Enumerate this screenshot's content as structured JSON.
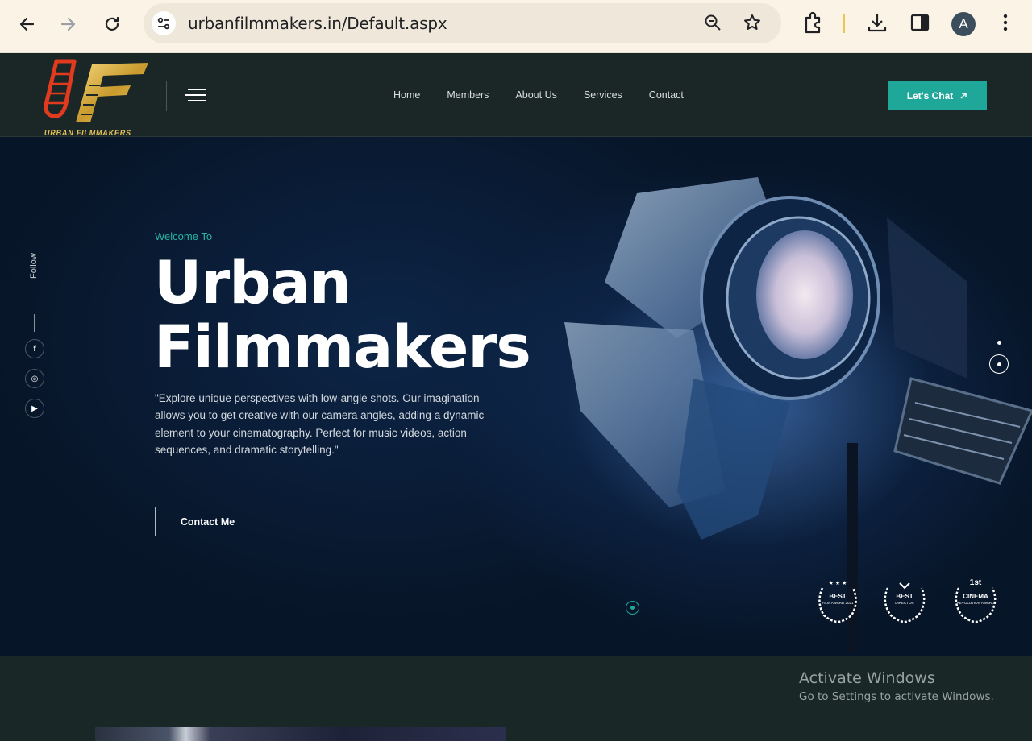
{
  "browser": {
    "url": "urbanfilmmakers.in/Default.aspx",
    "profile_initial": "A",
    "icons": [
      "back-icon",
      "forward-icon",
      "reload-icon",
      "site-info-icon",
      "zoom-icon",
      "bookmark-star-icon",
      "extensions-icon",
      "download-icon",
      "side-panel-icon",
      "more-menu-icon"
    ]
  },
  "header": {
    "logo_text_1": "URBAN",
    "logo_text_2": "FILMMAKERS",
    "nav": [
      "Home",
      "Members",
      "About Us",
      "Services",
      "Contact"
    ],
    "chat_label": "Let's Chat"
  },
  "hero": {
    "welcome": "Welcome To",
    "title_line1": "Urban",
    "title_line2": "Filmmakers",
    "description": "\"Explore unique perspectives with low-angle shots. Our imagination allows you to get creative with our camera angles, adding a dynamic element to your cinematography. Perfect for music videos, action sequences, and dramatic storytelling.\"",
    "contact_label": "Contact Me",
    "follow_label": "Follow",
    "social": [
      "f",
      "◎",
      "▶"
    ],
    "awards": [
      {
        "title": "BEST",
        "sub": "FILM AWARD 2021"
      },
      {
        "title": "BEST",
        "sub": "DIRECTOR"
      },
      {
        "title": "CINEMA",
        "sub": "REVOLUTION AWARD",
        "rank": "1st"
      }
    ]
  },
  "overlay": {
    "activate_title": "Activate Windows",
    "activate_sub": "Go to Settings to activate Windows."
  },
  "colors": {
    "accent": "#1fa79a",
    "header_bg": "#1b2727",
    "hero_bg": "#071426"
  }
}
